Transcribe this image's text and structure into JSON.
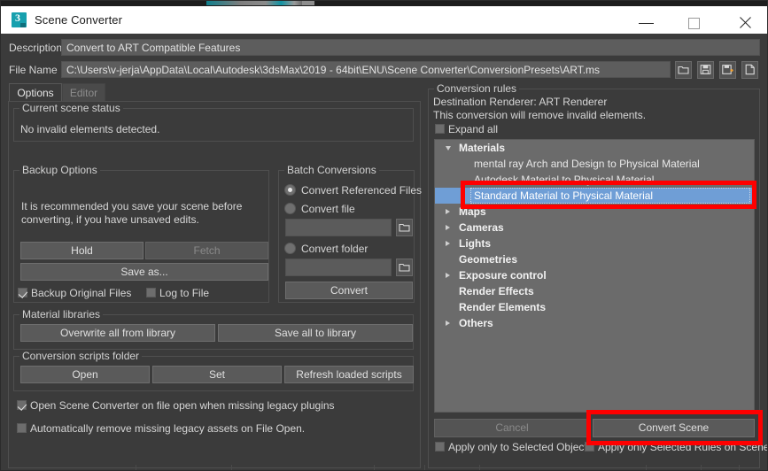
{
  "window": {
    "title": "Scene Converter",
    "app_icon": "3dsmax-icon",
    "minimize": "minimize-icon",
    "maximize": "maximize-icon",
    "close": "close-icon"
  },
  "header": {
    "description_label": "Description",
    "description_value": "Convert to ART Compatible Features",
    "file_name_label": "File Name",
    "file_name_value": "C:\\Users\\v-jerja\\AppData\\Local\\Autodesk\\3dsMax\\2019 - 64bit\\ENU\\Scene Converter\\ConversionPresets\\ART.ms",
    "toolbar_icons": [
      "open-folder-icon",
      "save-icon",
      "save-as-icon",
      "new-file-icon"
    ]
  },
  "tabs": [
    {
      "label": "Options",
      "selected": true
    },
    {
      "label": "Editor",
      "selected": false
    }
  ],
  "scene_status": {
    "caption": "Current scene status",
    "message": "No invalid elements detected."
  },
  "backup_options": {
    "caption": "Backup Options",
    "note_line1": "It is recommended you save your scene before",
    "note_line2": "converting, if you have unsaved edits.",
    "hold_button": "Hold",
    "fetch_button": "Fetch",
    "save_as_button": "Save as...",
    "backup_original_files": "Backup Original Files",
    "backup_original_files_checked": true,
    "log_to_file": "Log to File",
    "log_to_file_checked": false
  },
  "batch_conversions": {
    "caption": "Batch Conversions",
    "radio_referenced": "Convert Referenced Files",
    "radio_referenced_selected": true,
    "radio_file": "Convert file",
    "radio_file_selected": false,
    "file_path_value": "",
    "file_browse_icon": "open-folder-icon",
    "radio_folder": "Convert folder",
    "radio_folder_selected": false,
    "folder_path_value": "",
    "folder_browse_icon": "open-folder-icon",
    "convert_button": "Convert"
  },
  "material_libraries": {
    "caption": "Material libraries",
    "overwrite_button": "Overwrite all from library",
    "save_all_button": "Save all to library"
  },
  "conversion_scripts": {
    "caption": "Conversion scripts folder",
    "open_button": "Open",
    "set_button": "Set",
    "refresh_button": "Refresh loaded scripts"
  },
  "global_options": [
    {
      "label": "Open Scene Converter on file open when missing legacy plugins",
      "checked": true
    },
    {
      "label": "Automatically remove missing legacy assets on File Open.",
      "checked": false
    }
  ],
  "conversion_rules": {
    "caption": "Conversion rules",
    "destination_renderer": "Destination Renderer: ART Renderer",
    "warning": "This conversion will remove invalid elements.",
    "expand_all_label": "Expand all",
    "expand_all_checked": false,
    "tree": [
      {
        "label": "Materials",
        "type": "category",
        "expander": "open"
      },
      {
        "label": "mental ray Arch and Design to Physical Material",
        "type": "leaf"
      },
      {
        "label": "Autodesk Material to Physical Material",
        "type": "leaf"
      },
      {
        "label": "Standard Material to Physical Material",
        "type": "leaf",
        "selected": true
      },
      {
        "label": "Maps",
        "type": "category",
        "expander": "closed"
      },
      {
        "label": "Cameras",
        "type": "category",
        "expander": "closed"
      },
      {
        "label": "Lights",
        "type": "category",
        "expander": "closed"
      },
      {
        "label": "Geometries",
        "type": "category",
        "expander": "none"
      },
      {
        "label": "Exposure control",
        "type": "category",
        "expander": "closed"
      },
      {
        "label": "Render Effects",
        "type": "category",
        "expander": "none"
      },
      {
        "label": "Render Elements",
        "type": "category",
        "expander": "none"
      },
      {
        "label": "Others",
        "type": "category",
        "expander": "closed"
      }
    ],
    "cancel_button": "Cancel",
    "convert_scene_button": "Convert Scene",
    "apply_selected_objects": "Apply only to Selected Objects",
    "apply_selected_objects_checked": false,
    "apply_selected_rules": "Apply only Selected Rules on Scene",
    "apply_selected_rules_checked": false
  },
  "annotations": {
    "highlight_color": "#fe0000",
    "selection_color": "#6f9ed6"
  }
}
